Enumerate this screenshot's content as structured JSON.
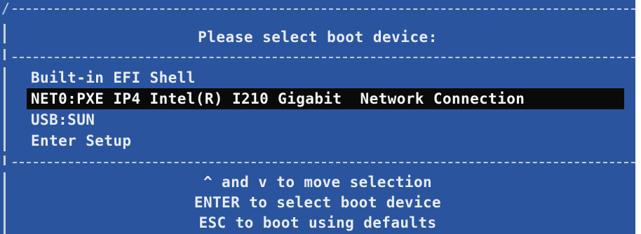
{
  "boot_menu": {
    "title": "Please select boot device:",
    "items": [
      {
        "label": "Built-in EFI Shell",
        "selected": false
      },
      {
        "label": "NET0:PXE IP4 Intel(R) I210 Gigabit  Network Connection",
        "selected": true
      },
      {
        "label": "USB:SUN",
        "selected": false
      },
      {
        "label": "Enter Setup",
        "selected": false
      }
    ],
    "help": [
      "^ and v to move selection",
      "ENTER to select boot device",
      "ESC to boot using defaults"
    ]
  },
  "colors": {
    "background": "#2a559e",
    "text": "#e9ecf2",
    "selection_background": "#0a0a0a",
    "border": "#c9d1e1"
  }
}
